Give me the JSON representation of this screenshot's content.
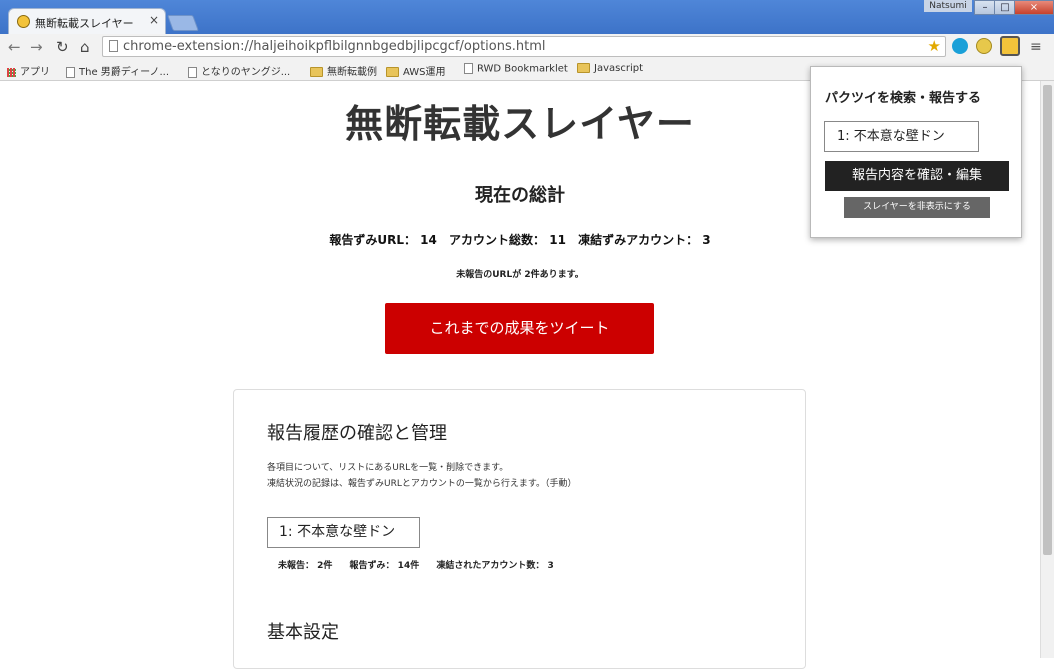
{
  "window": {
    "tab_title": "無断転載スレイヤー",
    "tab_close": "×",
    "user": "Natsumi",
    "min": "–",
    "max": "□",
    "close": "×"
  },
  "toolbar": {
    "url": "chrome-extension://haljeihoikpflbilgnnbgedbjlipcgcf/options.html"
  },
  "bookmarks": [
    "アプリ",
    "The 男爵ディーノ...",
    "となりのヤングジ...",
    "無断転載例",
    "AWS運用",
    "RWD Bookmarklet",
    "Javascript"
  ],
  "page": {
    "title": "無断転載スレイヤー",
    "summary_title": "現在の総計",
    "stats": {
      "reported": "報告ずみURL： 14",
      "accounts": "アカウント総数： 11",
      "frozen": "凍結ずみアカウント： 3"
    },
    "notice": "未報告のURLが 2件あります。",
    "tweet_button": "これまでの成果をツイート",
    "history": {
      "title": "報告履歴の確認と管理",
      "desc_line1": "各項目について、リストにあるURLを一覧・削除できます。",
      "desc_line2": "凍結状況の記録は、報告ずみURLとアカウントの一覧から行えます。（手動）",
      "select_value": "1: 不本意な壁ドン",
      "unreported": "未報告： 2件",
      "reported": "報告ずみ： 14件",
      "frozen": "凍結されたアカウント数： 3"
    },
    "basic_settings_title": "基本設定"
  },
  "popup": {
    "title": "パクツイを検索・報告する",
    "select_value": "1: 不本意な壁ドン",
    "confirm_button": "報告内容を確認・編集",
    "hide_button": "スレイヤーを非表示にする"
  },
  "colors": {
    "tweet_button": "#cc0000",
    "popup_dark_button": "#222222",
    "popup_gray_button": "#666666"
  }
}
